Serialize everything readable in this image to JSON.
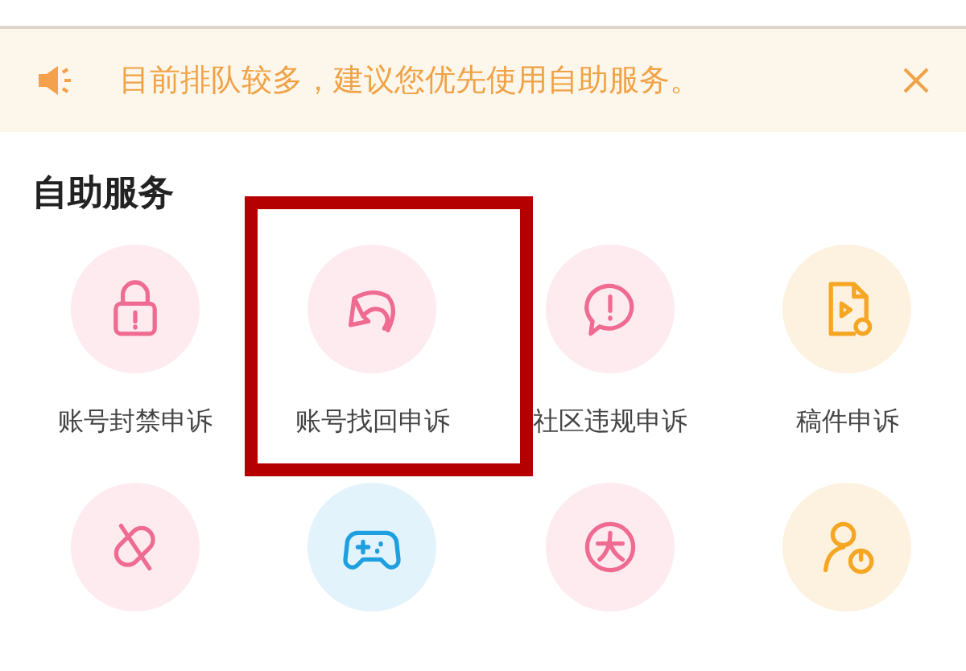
{
  "notice": {
    "text": "目前排队较多，建议您优先使用自助服务。"
  },
  "section": {
    "title": "自助服务",
    "items": [
      {
        "label": "账号封禁申诉",
        "color": "#f06b92",
        "highlighted": false
      },
      {
        "label": "账号找回申诉",
        "color": "#f06b92",
        "highlighted": true
      },
      {
        "label": "社区违规申诉",
        "color": "#f06b92",
        "highlighted": false
      },
      {
        "label": "稿件申诉",
        "color": "#f5a623",
        "highlighted": false
      },
      {
        "color": "#f06b92",
        "highlighted": false
      },
      {
        "color": "#1d9fe0",
        "highlighted": false
      },
      {
        "color": "#f06b92",
        "highlighted": false
      },
      {
        "color": "#f5a623",
        "highlighted": false
      }
    ]
  }
}
